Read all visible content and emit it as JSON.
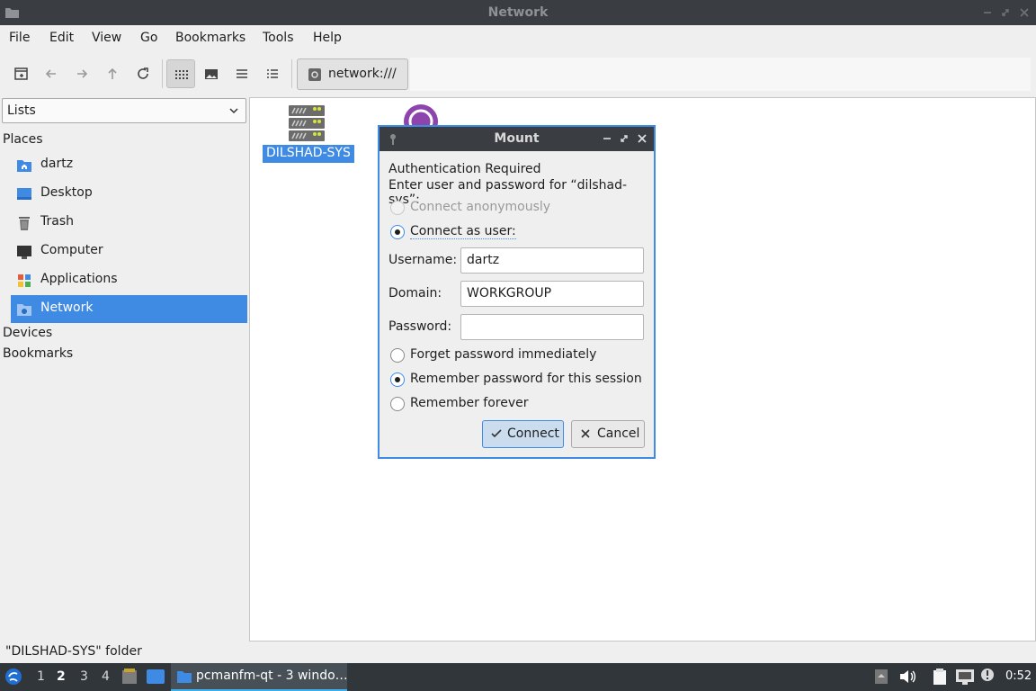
{
  "window": {
    "title": "Network"
  },
  "menu": [
    "File",
    "Edit",
    "View",
    "Go",
    "Bookmarks",
    "Tools",
    "Help"
  ],
  "toolbar": {
    "icons": [
      "new-tab-icon",
      "back-arrow-icon",
      "forward-arrow-icon",
      "up-arrow-icon",
      "reload-icon",
      "icon-view-icon",
      "thumbnail-view-icon",
      "compact-view-icon",
      "detailed-list-view-icon"
    ],
    "path": "network:///"
  },
  "sidebar": {
    "mode": "Lists",
    "places_label": "Places",
    "items": [
      {
        "label": "dartz",
        "icon": "home-folder-icon"
      },
      {
        "label": "Desktop",
        "icon": "desktop-icon"
      },
      {
        "label": "Trash",
        "icon": "trash-icon"
      },
      {
        "label": "Computer",
        "icon": "computer-icon"
      },
      {
        "label": "Applications",
        "icon": "applications-icon"
      },
      {
        "label": "Network",
        "icon": "network-icon",
        "selected": true
      }
    ],
    "devices_label": "Devices",
    "bookmarks_label": "Bookmarks"
  },
  "content": {
    "items": [
      {
        "label": "DILSHAD-SYS",
        "icon": "server-icon",
        "selected": true
      }
    ]
  },
  "status": "\"DILSHAD-SYS\" folder",
  "dialog": {
    "title": "Mount",
    "heading": "Authentication Required",
    "prompt": "Enter user and password for “dilshad-sys”:",
    "connect_anon": "Connect anonymously",
    "connect_user": "Connect as user:",
    "username_label": "Username:",
    "username_value": "dartz",
    "domain_label": "Domain:",
    "domain_value": "WORKGROUP",
    "password_label": "Password:",
    "password_value": "",
    "forget": "Forget password immediately",
    "remember_session": "Remember password for this session",
    "remember_forever": "Remember forever",
    "connect_btn": "Connect",
    "cancel_btn": "Cancel"
  },
  "taskbar": {
    "workspaces": [
      "1",
      "2",
      "3",
      "4"
    ],
    "current_workspace": "2",
    "task": "pcmanfm-qt - 3 windo…",
    "clock": "0:52"
  },
  "colors": {
    "accent": "#3f8ae2",
    "titlebar": "#3a3d42",
    "taskbar": "#31363b"
  }
}
